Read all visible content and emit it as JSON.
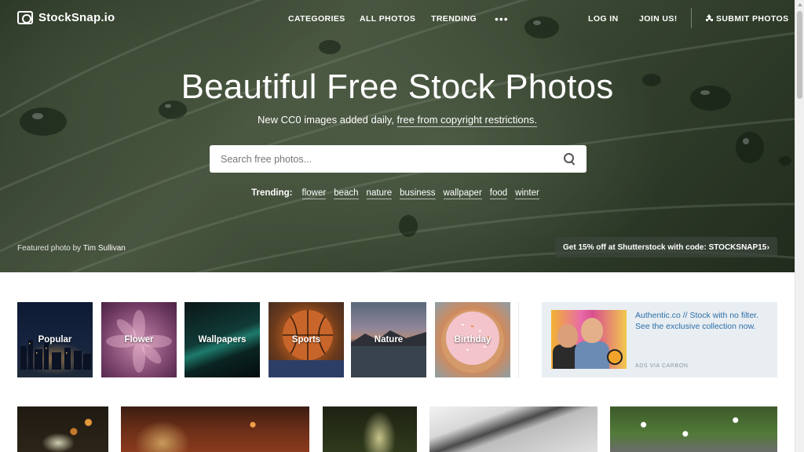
{
  "nav": {
    "logo": "StockSnap.io",
    "links": [
      "CATEGORIES",
      "ALL PHOTOS",
      "TRENDING"
    ],
    "more": "•••",
    "login": "LOG IN",
    "join": "JOIN US!",
    "submit": "SUBMIT PHOTOS"
  },
  "hero": {
    "title": "Beautiful Free Stock Photos",
    "subtitle_prefix": "New CC0 images added daily,",
    "subtitle_link": "free from copyright restrictions.",
    "search_placeholder": "Search free photos...",
    "trending_label": "Trending:",
    "trending": [
      "flower",
      "beach",
      "nature",
      "business",
      "wallpaper",
      "food",
      "winter"
    ],
    "featured_prefix": "Featured photo by",
    "featured_name": "Tim Sullivan",
    "promo": "Get 15% off at Shutterstock with code: STOCKSNAP15",
    "promo_chevron": "›"
  },
  "categories": [
    {
      "label": "Popular"
    },
    {
      "label": "Flower"
    },
    {
      "label": "Wallpapers"
    },
    {
      "label": "Sports"
    },
    {
      "label": "Nature"
    },
    {
      "label": "Birthday"
    }
  ],
  "ad": {
    "text": "Authentic.co // Stock with no filter. See the exclusive collection now.",
    "via": "ADS VIA CARBON"
  },
  "colors": {
    "ad_link": "#2b6ea8",
    "ad_bg": "#e9eef2",
    "promo_bg": "#3c463c"
  }
}
